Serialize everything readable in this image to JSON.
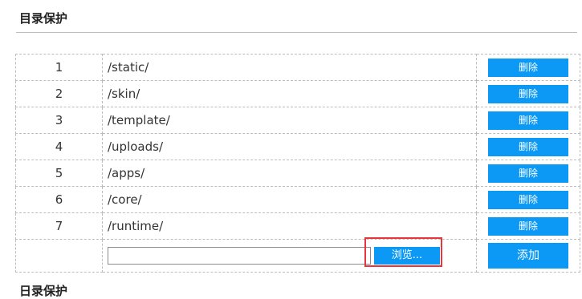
{
  "section_title": "目录保护",
  "rows": [
    {
      "num": "1",
      "path": "/static/",
      "action": "删除"
    },
    {
      "num": "2",
      "path": "/skin/",
      "action": "删除"
    },
    {
      "num": "3",
      "path": "/template/",
      "action": "删除"
    },
    {
      "num": "4",
      "path": "/uploads/",
      "action": "删除"
    },
    {
      "num": "5",
      "path": "/apps/",
      "action": "删除"
    },
    {
      "num": "6",
      "path": "/core/",
      "action": "删除"
    },
    {
      "num": "7",
      "path": "/runtime/",
      "action": "删除"
    }
  ],
  "add_row": {
    "input_value": "",
    "browse_label": "浏览...",
    "add_label": "添加"
  },
  "next_section_title": "日录保护",
  "colors": {
    "button": "#0b99f5",
    "highlight": "#e8353b",
    "border": "#bdbdbd"
  }
}
